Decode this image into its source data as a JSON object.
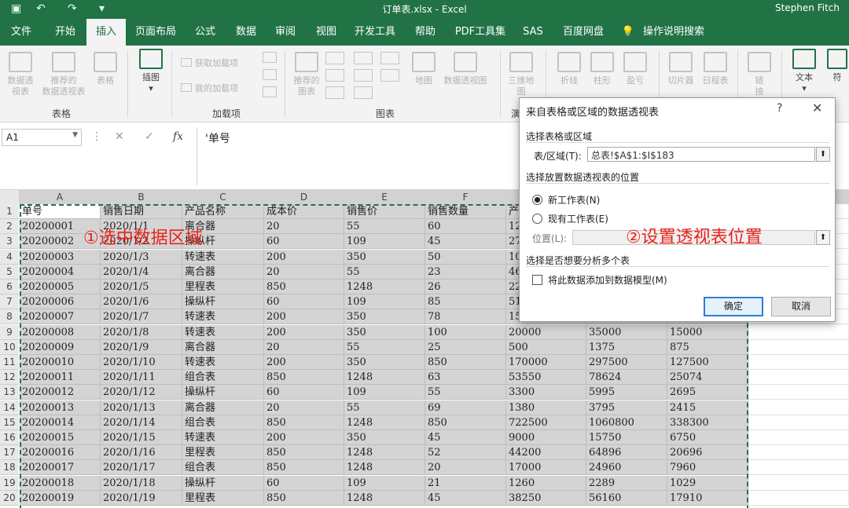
{
  "titlebar": {
    "doc_title": "订单表.xlsx  -  Excel",
    "user": "Stephen Fitch"
  },
  "tabs": [
    {
      "label": "文件"
    },
    {
      "label": "开始"
    },
    {
      "label": "插入"
    },
    {
      "label": "页面布局"
    },
    {
      "label": "公式"
    },
    {
      "label": "数据"
    },
    {
      "label": "审阅"
    },
    {
      "label": "视图"
    },
    {
      "label": "开发工具"
    },
    {
      "label": "帮助"
    },
    {
      "label": "PDF工具集"
    },
    {
      "label": "SAS"
    },
    {
      "label": "百度网盘"
    },
    {
      "label": "操作说明搜索"
    }
  ],
  "ribbon": {
    "pivot_line1": "数据透",
    "pivot_line2": "视表",
    "rec_pivot_line1": "推荐的",
    "rec_pivot_line2": "数据透视表",
    "table": "表格",
    "group_tables": "表格",
    "illustrations": "插图",
    "get_addins": "获取加载项",
    "my_addins": "我的加载项",
    "group_addins": "加载项",
    "rec_charts_line1": "推荐的",
    "rec_charts_line2": "图表",
    "map": "地图",
    "pivot_chart": "数据透视图",
    "group_charts": "图表",
    "map3d_line1": "三维地",
    "map3d_line2": "图",
    "group_tours": "演",
    "line": "折线",
    "column": "柱形",
    "winloss": "盈亏",
    "slicer": "切片器",
    "timeline": "日程表",
    "link_line1": "链",
    "link_line2": "接",
    "text": "文本",
    "symbol": "符"
  },
  "formula_bar": {
    "name_box": "A1",
    "formula": "'单号"
  },
  "grid": {
    "columns": [
      "A",
      "B",
      "C",
      "D",
      "E",
      "F"
    ],
    "rows": [
      [
        "单号",
        "销售日期",
        "产品名称",
        "成本价",
        "销售价",
        "销售数量",
        "产",
        "",
        ""
      ],
      [
        "20200001",
        "2020/1/1",
        "离合器",
        "20",
        "55",
        "60",
        "12",
        "",
        ""
      ],
      [
        "20200002",
        "2020/1/2",
        "操纵杆",
        "60",
        "109",
        "45",
        "27",
        "",
        ""
      ],
      [
        "20200003",
        "2020/1/3",
        "转速表",
        "200",
        "350",
        "50",
        "10",
        "",
        ""
      ],
      [
        "20200004",
        "2020/1/4",
        "离合器",
        "20",
        "55",
        "23",
        "46",
        "",
        ""
      ],
      [
        "20200005",
        "2020/1/5",
        "里程表",
        "850",
        "1248",
        "26",
        "22",
        "",
        ""
      ],
      [
        "20200006",
        "2020/1/6",
        "操纵杆",
        "60",
        "109",
        "85",
        "51",
        "",
        ""
      ],
      [
        "20200007",
        "2020/1/7",
        "转速表",
        "200",
        "350",
        "78",
        "15",
        "",
        ""
      ],
      [
        "20200008",
        "2020/1/8",
        "转速表",
        "200",
        "350",
        "100",
        "20000",
        "35000",
        "15000"
      ],
      [
        "20200009",
        "2020/1/9",
        "离合器",
        "20",
        "55",
        "25",
        "500",
        "1375",
        "875"
      ],
      [
        "20200010",
        "2020/1/10",
        "转速表",
        "200",
        "350",
        "850",
        "170000",
        "297500",
        "127500"
      ],
      [
        "20200011",
        "2020/1/11",
        "组合表",
        "850",
        "1248",
        "63",
        "53550",
        "78624",
        "25074"
      ],
      [
        "20200012",
        "2020/1/12",
        "操纵杆",
        "60",
        "109",
        "55",
        "3300",
        "5995",
        "2695"
      ],
      [
        "20200013",
        "2020/1/13",
        "离合器",
        "20",
        "55",
        "69",
        "1380",
        "3795",
        "2415"
      ],
      [
        "20200014",
        "2020/1/14",
        "组合表",
        "850",
        "1248",
        "850",
        "722500",
        "1060800",
        "338300"
      ],
      [
        "20200015",
        "2020/1/15",
        "转速表",
        "200",
        "350",
        "45",
        "9000",
        "15750",
        "6750"
      ],
      [
        "20200016",
        "2020/1/16",
        "里程表",
        "850",
        "1248",
        "52",
        "44200",
        "64896",
        "20696"
      ],
      [
        "20200017",
        "2020/1/17",
        "组合表",
        "850",
        "1248",
        "20",
        "17000",
        "24960",
        "7960"
      ],
      [
        "20200018",
        "2020/1/18",
        "操纵杆",
        "60",
        "109",
        "21",
        "1260",
        "2289",
        "1029"
      ],
      [
        "20200019",
        "2020/1/19",
        "里程表",
        "850",
        "1248",
        "45",
        "38250",
        "56160",
        "17910"
      ]
    ]
  },
  "annotations": {
    "select_range": "①选中数据区域",
    "set_position": "②设置透视表位置"
  },
  "dialog": {
    "title": "来自表格或区域的数据透视表",
    "help": "?",
    "close": "✕",
    "section_source": "选择表格或区域",
    "range_label": "表/区域(T):",
    "range_value": "总表!$A$1:$I$183",
    "section_dest": "选择放置数据透视表的位置",
    "new_sheet": "新工作表(N)",
    "existing_sheet": "现有工作表(E)",
    "location_label": "位置(L):",
    "location_value": "",
    "section_multi": "选择是否想要分析多个表",
    "add_to_model": "将此数据添加到数据模型(M)",
    "ok": "确定",
    "cancel": "取消",
    "collapse_glyph": "⬆"
  }
}
